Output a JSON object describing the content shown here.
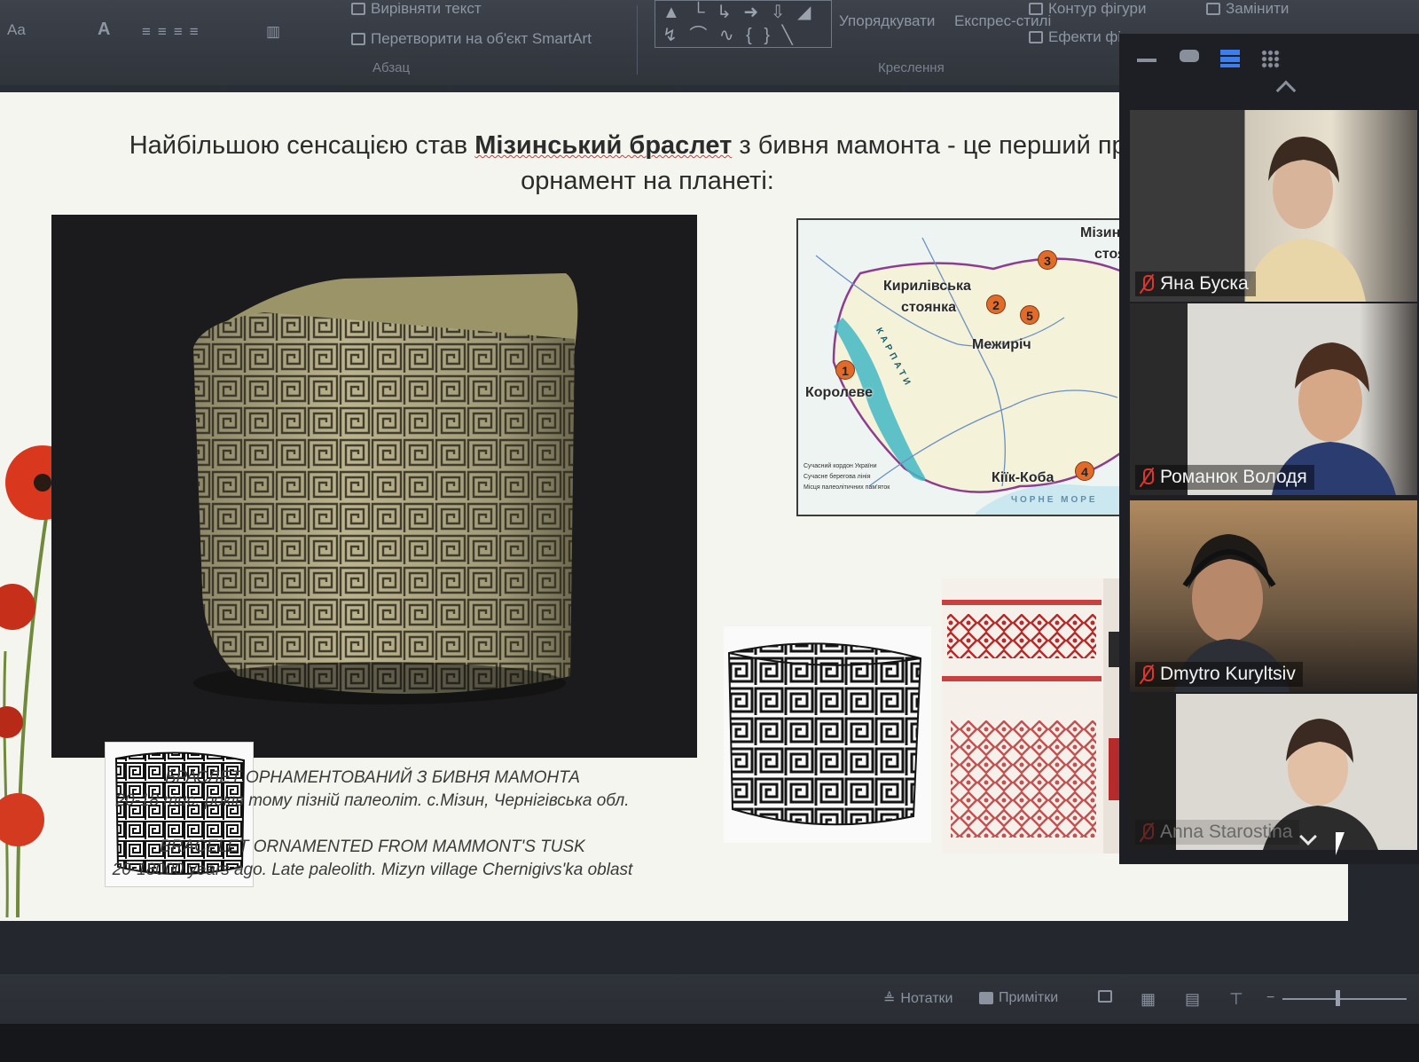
{
  "ribbon": {
    "paragraph_items": [
      "Вирівняти текст",
      "Перетворити на об'єкт SmartArt"
    ],
    "group_paragraph": "Абзац",
    "arrange": "Упорядкувати",
    "quick_styles": "Експрес-стилі",
    "shape_outline": "Контур фігури",
    "shape_effects": "Ефекти фігури",
    "replace": "Замінити",
    "group_drawing": "Креслення",
    "left_label": "Aa"
  },
  "slide": {
    "title_part1": "Найбільшою сенсацією став ",
    "title_bold": "Мізинський браслет",
    "title_part2": " з бивня мамонта - це перший прото",
    "title_line2": "орнамент на планеті:",
    "caption": {
      "ua_line1": "БРАСЛЕТ ОРНАМЕНТОВАНИЙ З БИВНЯ  МАМОНТА",
      "ua_line2": "20-18 тис. років тому пізній палеоліт.    с.Мізин, Чернігівська обл.",
      "en_line1": "BRACELET  ORNAMENTED FROM  MAMMONT'S  TUSK",
      "en_line2": "20-18000 years ago. Late paleolith.   Mizyn village  Chernigivs'ka oblast"
    },
    "map": {
      "labels": [
        "Мізин",
        "стоя",
        "Кирилівська",
        "стоянка",
        "Межиріч",
        "Королеве",
        "Кіїк-Коба",
        "КАРПАТИ",
        "ЧОРНЕ  МОРЕ"
      ],
      "numbers": [
        "1",
        "2",
        "3",
        "4",
        "5"
      ],
      "legend": [
        "Сучасний кордон України",
        "Сучасне берегова лінія",
        "Місця палеолітичних пам'яток"
      ]
    }
  },
  "participants": [
    {
      "name": "Яна Буска",
      "muted": true
    },
    {
      "name": "Романюк Володя",
      "muted": true
    },
    {
      "name": "Dmytro Kuryltsiv",
      "muted": true
    },
    {
      "name": "Anna Starostina",
      "muted": true
    }
  ],
  "statusbar": {
    "notes": "Нотатки",
    "comments": "Примітки"
  },
  "colors": {
    "accent_red": "#e0342e",
    "ribbon_bg": "#30343b",
    "slide_bg": "#f4f5ef"
  }
}
